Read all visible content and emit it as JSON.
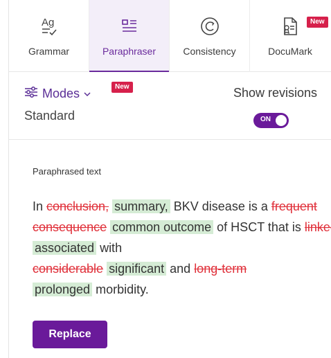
{
  "tabs": [
    {
      "label": "Grammar",
      "icon": "grammar-icon",
      "active": false
    },
    {
      "label": "Paraphraser",
      "icon": "paraphraser-icon",
      "active": true
    },
    {
      "label": "Consistency",
      "icon": "consistency-icon",
      "active": false
    },
    {
      "label": "DocuMark",
      "icon": "documark-icon",
      "active": false,
      "badge": "New"
    }
  ],
  "modes": {
    "label": "Modes",
    "badge": "New",
    "current": "Standard",
    "show_revisions_label": "Show revisions",
    "toggle_state": "ON"
  },
  "panel": {
    "label": "Paraphrased text",
    "text": {
      "t0": "In ",
      "del0": "conclusion,",
      "ins0": "summary,",
      "t1": " BKV disease is a ",
      "del1": "frequent consequence",
      "ins1": "common outcome",
      "t2": " of HSCT that is ",
      "del2": "linked",
      "ins2": "associated",
      "t3": " with ",
      "del3": "considerable",
      "ins3": "significant",
      "t4": " and ",
      "del4": "long-term",
      "ins4": "prolonged",
      "t5": " morbidity."
    },
    "replace_label": "Replace"
  },
  "colors": {
    "accent": "#6a1a9a",
    "badge": "#d6204b",
    "deletion": "#e0303a",
    "insertion_bg": "#d5ecd5"
  }
}
